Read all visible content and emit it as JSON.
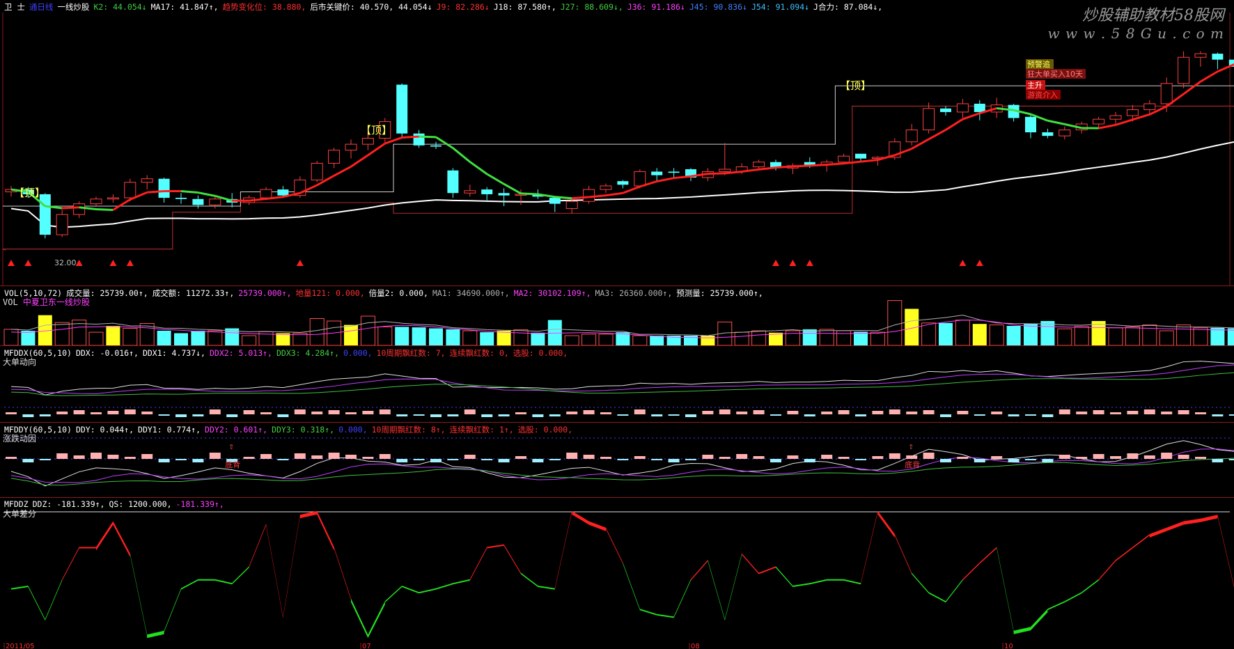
{
  "header": {
    "items": [
      {
        "t": "卫 士",
        "c": "#ffffff"
      },
      {
        "t": "通日线",
        "c": "#4040ff"
      },
      {
        "t": "一线炒股",
        "c": "#ffffff"
      },
      {
        "t": "K2: 44.054↓",
        "c": "#40d040"
      },
      {
        "t": "MA17: 41.847↑,",
        "c": "#ffffff"
      },
      {
        "t": "趋势变化位: 38.880,",
        "c": "#ff3030"
      },
      {
        "t": "后市关键价: 40.570, 44.054↓",
        "c": "#ffffff"
      },
      {
        "t": "J9: 82.286↓",
        "c": "#ff3030"
      },
      {
        "t": "J18: 87.580↑,",
        "c": "#ffffff"
      },
      {
        "t": "J27: 88.609↓,",
        "c": "#40d040"
      },
      {
        "t": "J36: 91.186↓",
        "c": "#ff40ff"
      },
      {
        "t": "J45: 90.836↓",
        "c": "#4080ff"
      },
      {
        "t": "J54: 91.094↓",
        "c": "#40c0ff"
      },
      {
        "t": "J合力: 87.084↓,",
        "c": "#ffffff"
      }
    ]
  },
  "watermark": {
    "line1": "炒股辅助教材58股网",
    "line2": "w w w . 5 8 G u . c o m"
  },
  "main_annotations": {
    "top_labels": [
      "【顶】",
      "【顶】",
      "【顶】",
      "【顶】"
    ],
    "price_note": "32.00",
    "tags": [
      "预警追",
      "狂大单买入10天",
      "主升",
      "游资介入"
    ]
  },
  "vol_pane": {
    "header": [
      {
        "t": "VOL(5,10,72)",
        "c": "#ffffff"
      },
      {
        "t": "成交量: 25739.00↑,",
        "c": "#ffffff"
      },
      {
        "t": "成交额: 11272.33↑,",
        "c": "#ffffff"
      },
      {
        "t": "25739.000↑,",
        "c": "#ff40ff"
      },
      {
        "t": "地量121: 0.000,",
        "c": "#ff3030"
      },
      {
        "t": "倍量2: 0.000,",
        "c": "#ffffff"
      },
      {
        "t": "MA1: 34690.000↑,",
        "c": "#b0b0b0"
      },
      {
        "t": "MA2: 30102.109↑,",
        "c": "#ff40ff"
      },
      {
        "t": "MA3: 26360.000↑,",
        "c": "#b0b0b0"
      },
      {
        "t": "预测量: 25739.000↑,",
        "c": "#ffffff"
      }
    ],
    "sub_prefix": "VOL",
    "sub_label": "中夏卫东一线炒股"
  },
  "ddx_pane": {
    "header": [
      {
        "t": "MFDDX(60,5,10)",
        "c": "#ffffff"
      },
      {
        "t": "DDX: -0.016↑,",
        "c": "#ffffff"
      },
      {
        "t": "DDX1: 4.737↓,",
        "c": "#ffffff"
      },
      {
        "t": "DDX2: 5.013↑,",
        "c": "#ff40ff"
      },
      {
        "t": "DDX3: 4.284↑,",
        "c": "#40d040"
      },
      {
        "t": "0.000,",
        "c": "#4040ff"
      },
      {
        "t": "10周期飘红数: 7,",
        "c": "#ff3030"
      },
      {
        "t": "连续飘红数: 0,",
        "c": "#ff3030"
      },
      {
        "t": "选股: 0.000,",
        "c": "#ff3030"
      }
    ],
    "sub_label": "大单动向"
  },
  "ddy_pane": {
    "header": [
      {
        "t": "MFDDY(60,5,10)",
        "c": "#ffffff"
      },
      {
        "t": "DDY: 0.044↑,",
        "c": "#ffffff"
      },
      {
        "t": "DDY1: 0.774↑,",
        "c": "#ffffff"
      },
      {
        "t": "DDY2: 0.601↑,",
        "c": "#ff40ff"
      },
      {
        "t": "DDY3: 0.318↑,",
        "c": "#40d040"
      },
      {
        "t": "0.000,",
        "c": "#4040ff"
      },
      {
        "t": "10周期飘红数: 8↑,",
        "c": "#ff3030"
      },
      {
        "t": "连续飘红数: 1↑,",
        "c": "#ff3030"
      },
      {
        "t": "选股: 0.000,",
        "c": "#ff3030"
      }
    ],
    "sub_label": "涨跌动因",
    "marks": [
      "底背",
      "底背"
    ]
  },
  "ddz_pane": {
    "header": [
      {
        "t": "MFDDZ",
        "c": "#ffffff"
      },
      {
        "t": "DDZ: -181.339↑,",
        "c": "#ffffff"
      },
      {
        "t": "QS: 1200.000,",
        "c": "#ffffff"
      },
      {
        "t": "-181.339↑,",
        "c": "#ff40ff"
      }
    ],
    "sub_label": "大单差分"
  },
  "chart_data": {
    "type": "candlestick",
    "candles_ohlc": [
      [
        38.4,
        38.9,
        38.0,
        38.6
      ],
      [
        38.6,
        38.8,
        37.9,
        38.2
      ],
      [
        38.2,
        38.3,
        34.5,
        34.8
      ],
      [
        34.8,
        36.9,
        34.6,
        36.5
      ],
      [
        36.5,
        37.6,
        36.2,
        37.4
      ],
      [
        37.4,
        38.0,
        37.2,
        37.8
      ],
      [
        37.8,
        38.2,
        37.5,
        37.9
      ],
      [
        37.9,
        39.5,
        37.6,
        39.2
      ],
      [
        39.2,
        39.8,
        38.6,
        39.5
      ],
      [
        39.5,
        39.6,
        37.5,
        37.9
      ],
      [
        37.9,
        38.3,
        37.4,
        37.8
      ],
      [
        37.8,
        38.1,
        37.0,
        37.3
      ],
      [
        37.3,
        38.0,
        37.0,
        37.8
      ],
      [
        37.8,
        38.3,
        37.1,
        37.5
      ],
      [
        37.5,
        38.1,
        37.3,
        37.9
      ],
      [
        37.9,
        38.8,
        37.7,
        38.6
      ],
      [
        38.6,
        38.9,
        37.9,
        38.1
      ],
      [
        38.1,
        39.7,
        37.9,
        39.4
      ],
      [
        39.4,
        41.0,
        39.2,
        40.8
      ],
      [
        40.8,
        42.1,
        40.4,
        41.9
      ],
      [
        41.9,
        42.8,
        41.2,
        42.4
      ],
      [
        42.4,
        43.4,
        41.9,
        42.9
      ],
      [
        42.9,
        44.6,
        42.5,
        44.3
      ],
      [
        47.4,
        47.5,
        43.0,
        43.3
      ],
      [
        43.3,
        43.6,
        42.1,
        42.3
      ],
      [
        42.3,
        42.6,
        42.0,
        42.2
      ],
      [
        40.2,
        40.4,
        37.9,
        38.3
      ],
      [
        38.3,
        39.0,
        38.0,
        38.5
      ],
      [
        38.6,
        38.8,
        37.7,
        38.2
      ],
      [
        38.3,
        38.7,
        37.2,
        38.1
      ],
      [
        38.2,
        38.6,
        37.3,
        38.2
      ],
      [
        38.2,
        38.6,
        37.8,
        38.0
      ],
      [
        37.9,
        38.0,
        36.7,
        37.4
      ],
      [
        37.0,
        37.9,
        36.6,
        37.6
      ],
      [
        37.6,
        38.9,
        37.4,
        38.6
      ],
      [
        38.6,
        39.1,
        38.3,
        38.9
      ],
      [
        39.3,
        39.4,
        38.7,
        39.0
      ],
      [
        38.9,
        40.3,
        38.7,
        40.1
      ],
      [
        40.1,
        40.4,
        39.3,
        39.8
      ],
      [
        40.1,
        40.4,
        39.5,
        40.0
      ],
      [
        40.3,
        40.4,
        39.3,
        39.6
      ],
      [
        39.6,
        40.4,
        39.3,
        40.1
      ],
      [
        40.1,
        42.5,
        39.8,
        40.3
      ],
      [
        40.1,
        40.8,
        39.9,
        40.5
      ],
      [
        40.5,
        41.1,
        40.3,
        40.9
      ],
      [
        40.9,
        41.1,
        40.2,
        40.4
      ],
      [
        40.4,
        40.8,
        39.9,
        40.6
      ],
      [
        40.9,
        41.3,
        40.4,
        40.6
      ],
      [
        40.7,
        41.1,
        40.1,
        40.9
      ],
      [
        40.9,
        41.6,
        40.7,
        41.4
      ],
      [
        41.6,
        41.6,
        41.0,
        41.2
      ],
      [
        41.2,
        41.4,
        40.6,
        41.3
      ],
      [
        41.3,
        42.9,
        41.1,
        42.6
      ],
      [
        42.6,
        44.1,
        42.3,
        43.6
      ],
      [
        43.6,
        45.9,
        43.3,
        45.4
      ],
      [
        45.4,
        45.6,
        44.8,
        45.1
      ],
      [
        45.1,
        46.2,
        44.6,
        45.8
      ],
      [
        45.8,
        46.1,
        44.4,
        45.1
      ],
      [
        45.1,
        46.3,
        44.6,
        45.7
      ],
      [
        45.7,
        45.8,
        44.3,
        44.6
      ],
      [
        44.7,
        44.9,
        42.9,
        43.4
      ],
      [
        43.4,
        43.7,
        42.9,
        43.1
      ],
      [
        43.1,
        43.9,
        42.8,
        43.6
      ],
      [
        43.6,
        44.3,
        43.3,
        44.1
      ],
      [
        44.1,
        44.7,
        43.7,
        44.5
      ],
      [
        44.5,
        45.1,
        44.0,
        44.8
      ],
      [
        44.8,
        45.7,
        44.3,
        45.3
      ],
      [
        45.3,
        46.1,
        44.8,
        45.8
      ],
      [
        45.8,
        48.0,
        45.1,
        47.5
      ],
      [
        47.5,
        50.2,
        47.1,
        49.7
      ],
      [
        49.7,
        50.2,
        48.9,
        50.0
      ],
      [
        50.0,
        50.1,
        48.7,
        49.5
      ],
      [
        49.5,
        49.6,
        48.4,
        48.9
      ]
    ],
    "x_date_labels": [
      "2011/05",
      "07",
      "08",
      "10"
    ]
  }
}
